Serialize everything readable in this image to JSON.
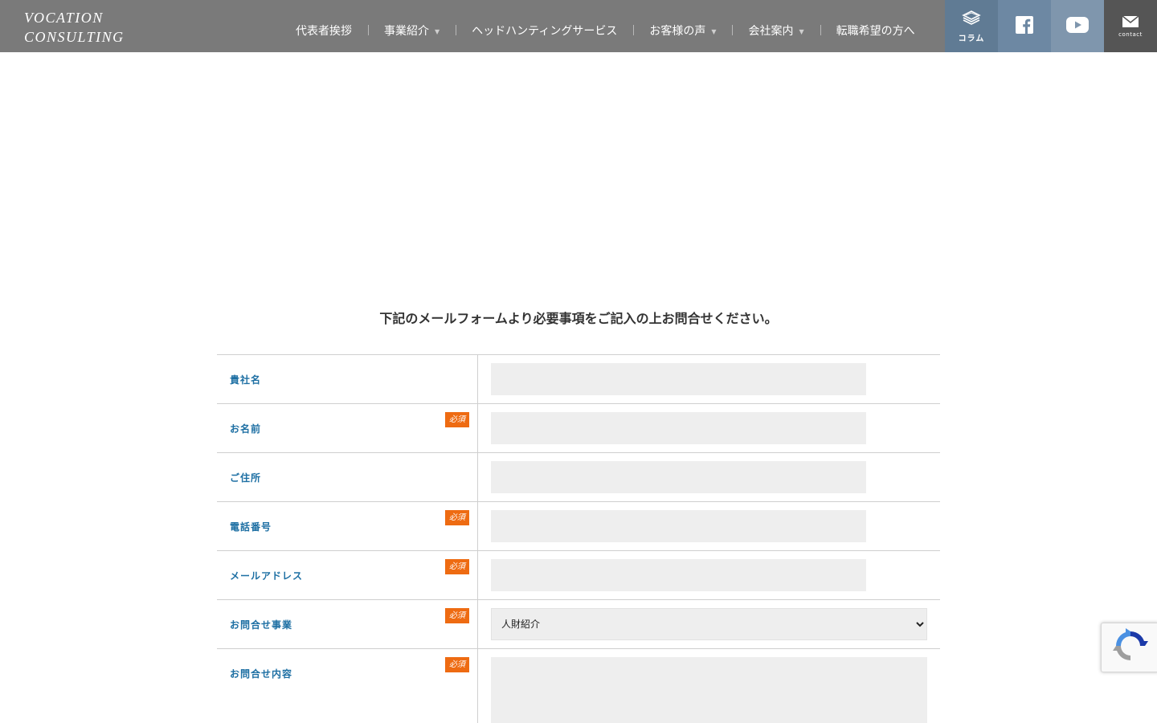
{
  "header": {
    "logo_line1": "VOCATION",
    "logo_line2": "CONSULTING",
    "nav": [
      {
        "label": "代表者挨拶",
        "caret": ""
      },
      {
        "label": "事業紹介",
        "caret": "▼"
      },
      {
        "label": "ヘッドハンティングサービス",
        "caret": ""
      },
      {
        "label": "お客様の声",
        "caret": "▼"
      },
      {
        "label": "会社案内",
        "caret": "▼"
      },
      {
        "label": "転職希望の方へ",
        "caret": ""
      }
    ],
    "tiles": {
      "column_label": "コラム",
      "contact_label": "contact"
    },
    "icons": {
      "column": "book-stack-icon",
      "facebook": "facebook-icon",
      "youtube": "youtube-icon",
      "contact": "mail-icon"
    }
  },
  "intro": "下記のメールフォームより必要事項をご記入の上お問合せください。",
  "form": {
    "required_label": "必須",
    "fields": [
      {
        "label": "貴社名",
        "value": "",
        "required": false
      },
      {
        "label": "お名前",
        "value": "",
        "required": true
      },
      {
        "label": "ご住所",
        "value": "",
        "required": false
      },
      {
        "label": "電話番号",
        "value": "",
        "required": true
      },
      {
        "label": "メールアドレス",
        "value": "",
        "required": true
      },
      {
        "label": "お問合せ事業",
        "value": "人財紹介",
        "required": true
      },
      {
        "label": "お問合せ内容",
        "value": "",
        "required": true
      }
    ]
  },
  "colors": {
    "header_bg": "#7a7a7a",
    "label_blue": "#1d6fa3",
    "required_orange": "#ee6b12",
    "input_bg": "#eeeeee"
  }
}
